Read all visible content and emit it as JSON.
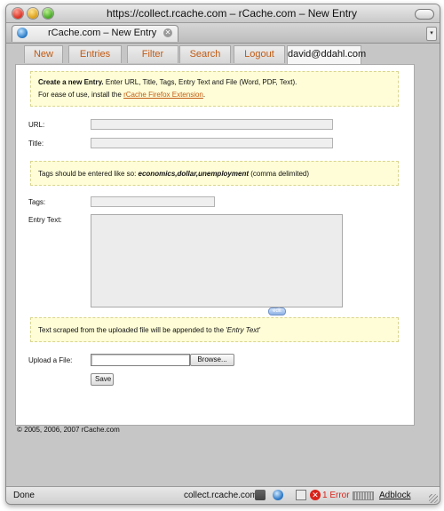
{
  "window": {
    "title": "https://collect.rcache.com – rCache.com – New Entry"
  },
  "browser_tab": {
    "label": "rCache.com – New Entry"
  },
  "nav": {
    "tabs": [
      {
        "label": "New"
      },
      {
        "label": "Entries"
      },
      {
        "label": "Filter"
      },
      {
        "label": "Search"
      },
      {
        "label": "Logout"
      },
      {
        "label": "david@ddahl.com"
      }
    ]
  },
  "intro": {
    "lead": "Create a new Entry.",
    "text1": " Enter URL, Title, Tags, Entry Text and File (Word, PDF, Text).",
    "text2": "For ease of use, install the ",
    "link": "rCache Firefox Extension",
    "text2_end": "."
  },
  "form": {
    "url_label": "URL:",
    "url_value": "",
    "title_label": "Title:",
    "title_value": "",
    "tags_label": "Tags:",
    "tags_value": "",
    "entry_text_label": "Entry Text:",
    "entry_text_value": "",
    "edit_label": "edit",
    "upload_label": "Upload a File:",
    "browse_label": "Browse...",
    "save_label": "Save"
  },
  "tags_note": {
    "text": "Tags should be entered like so: ",
    "example": "economics,dollar,unemployment",
    "suffix": " (comma delimited)"
  },
  "scrape_note": {
    "text": "Text scraped from the uploaded file will be appended to the ",
    "emph": "'Entry Text'"
  },
  "footer": {
    "copyright": "© 2005, 2006, 2007 rCache.com"
  },
  "status": {
    "left": "Done",
    "domain": "collect.rcache.com",
    "errors": "1 Error",
    "adblock": "Adblock"
  }
}
